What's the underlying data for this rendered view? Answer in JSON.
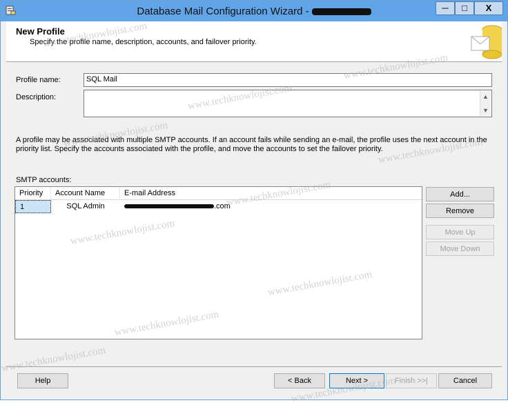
{
  "window": {
    "title": "Database Mail Configuration Wizard -",
    "minimize_glyph": "─",
    "maximize_glyph": "□",
    "close_glyph": "X"
  },
  "header": {
    "title": "New Profile",
    "subtitle": "Specify the profile name, description, accounts, and failover priority."
  },
  "form": {
    "profile_name_label": "Profile name:",
    "profile_name_value": "SQL Mail",
    "description_label": "Description:",
    "description_value": ""
  },
  "info_text": "A profile may be associated with multiple SMTP accounts. If an account fails while sending an e-mail, the profile uses the next account in the priority list. Specify the accounts associated with the profile, and move the accounts to set the failover priority.",
  "smtp": {
    "label": "SMTP accounts:",
    "columns": [
      "Priority",
      "Account Name",
      "E-mail Address"
    ],
    "rows": [
      {
        "priority": "1",
        "account_name": "SQL Admin",
        "email_suffix": ".com"
      }
    ]
  },
  "side_buttons": {
    "add": "Add...",
    "remove": "Remove",
    "move_up": "Move Up",
    "move_down": "Move Down"
  },
  "footer": {
    "help": "Help",
    "back": "< Back",
    "next": "Next >",
    "finish": "Finish >>|",
    "cancel": "Cancel"
  },
  "watermark": "www.techknowlojist.com",
  "colors": {
    "titlebar": "#61a5e8",
    "selection": "#cce4f7"
  }
}
